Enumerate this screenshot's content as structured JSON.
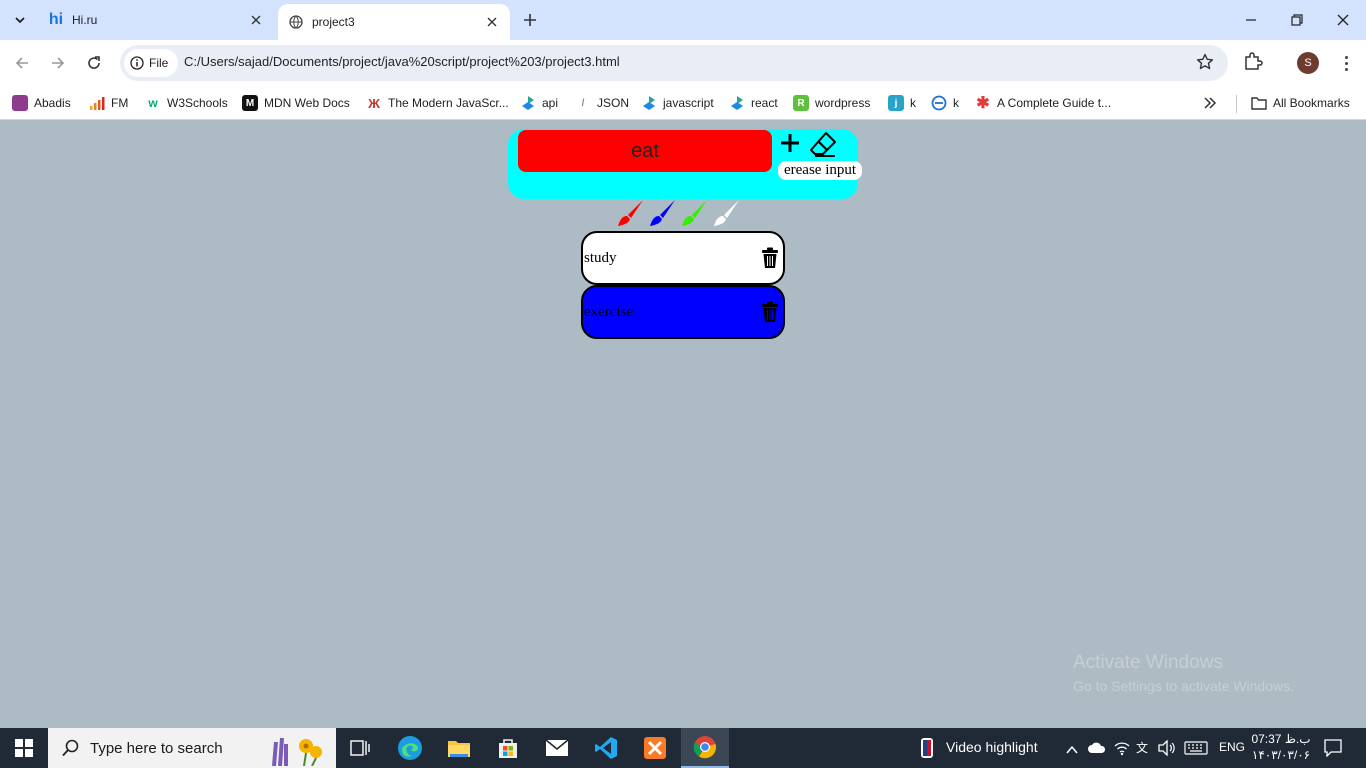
{
  "browser": {
    "tabs": [
      {
        "title": "Hi.ru",
        "favicon": "hi-ru-icon",
        "active": false
      },
      {
        "title": "project3",
        "favicon": "globe-icon",
        "active": true
      }
    ],
    "url_scheme_label": "File",
    "url": "C:/Users/sajad/Documents/project/java%20script/project%203/project3.html",
    "profile_initial": "S",
    "bookmarks": [
      {
        "label": "Abadis",
        "icon": "abadis-icon"
      },
      {
        "label": "FM",
        "icon": "signal-bars-icon"
      },
      {
        "label": "W3Schools",
        "icon": "w3schools-icon"
      },
      {
        "label": "MDN Web Docs",
        "icon": "mdn-icon"
      },
      {
        "label": "The Modern JavaScr...",
        "icon": "javascript-info-icon"
      },
      {
        "label": "api",
        "icon": "api-icon"
      },
      {
        "label": "JSON",
        "icon": "json-icon"
      },
      {
        "label": "javascript",
        "icon": "javascript-icon"
      },
      {
        "label": "react",
        "icon": "react-icon"
      },
      {
        "label": "wordpress",
        "icon": "wordpress-icon"
      },
      {
        "label": "k",
        "icon": "k-icon"
      },
      {
        "label": "k",
        "icon": "k2-icon"
      },
      {
        "label": "A Complete Guide t...",
        "icon": "asterisk-icon"
      }
    ],
    "all_bookmarks_label": "All Bookmarks"
  },
  "app": {
    "input_value": "eat",
    "erase_tooltip": "erease input",
    "brush_colors": [
      "#ff0000",
      "#0000ff",
      "#33ee00",
      "#ffffff"
    ],
    "todos": [
      {
        "text": "study",
        "bg": "#ffffff"
      },
      {
        "text": "exercise",
        "bg": "#0000ff"
      }
    ]
  },
  "watermark": {
    "line1": "Activate Windows",
    "line2": "Go to Settings to activate Windows."
  },
  "taskbar": {
    "search_placeholder": "Type here to search",
    "news_label": "Video highlight",
    "language": "ENG",
    "time": "07:37 ب.ظ",
    "date": "۱۴۰۳/۰۳/۰۶"
  },
  "colors": {
    "page_bg": "#adbbc4",
    "panel_bg": "#00ffff",
    "input_bg": "#ff0000",
    "tabstrip_bg": "#d3e3fd",
    "taskbar_bg": "#1f2a36"
  }
}
